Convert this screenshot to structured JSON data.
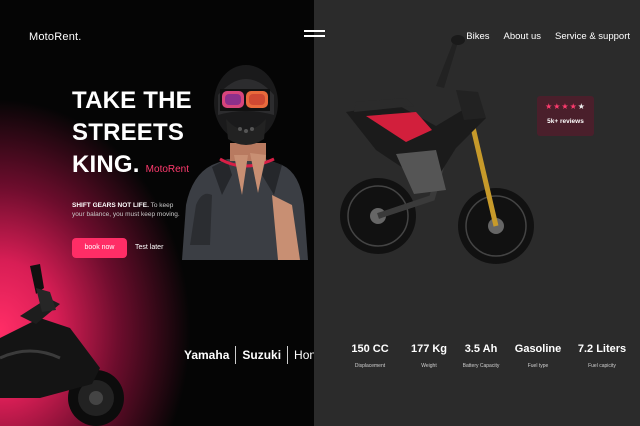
{
  "header": {
    "logo": "MotoRent.",
    "nav": [
      "Bikes",
      "About us",
      "Service & support"
    ]
  },
  "hero": {
    "line1": "TAKE THE",
    "line2": "STREETS",
    "line3": "KING.",
    "brand_tag": "MotoRent",
    "tagline_bold": "SHIFT GEARS NOT LIFE.",
    "tagline_rest": "To keep your balance, you must keep moving.",
    "book_label": "book now",
    "test_label": "Test later"
  },
  "brands": [
    "Yamaha",
    "Suzuki",
    "Honda"
  ],
  "reviews": {
    "rating": 4,
    "max": 5,
    "count": "5k+ reviews"
  },
  "specs": [
    {
      "value": "150 CC",
      "label": "Displacement"
    },
    {
      "value": "177 Kg",
      "label": "Weight"
    },
    {
      "value": "3.5 Ah",
      "label": "Battery Capacity"
    },
    {
      "value": "Gasoline",
      "label": "Fuel type"
    },
    {
      "value": "7.2 Liters",
      "label": "Fuel capicity"
    }
  ],
  "colors": {
    "accent": "#ff2d66",
    "dark": "#050505",
    "panel": "#2b2b2b"
  }
}
